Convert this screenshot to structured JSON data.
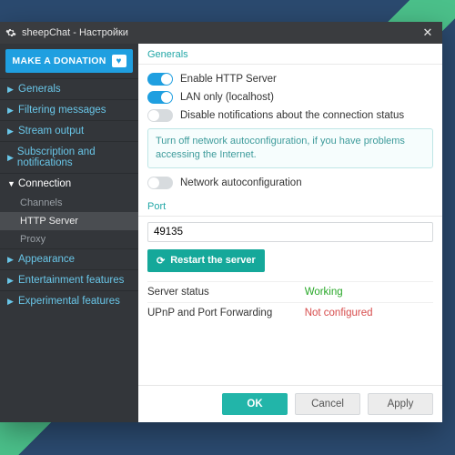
{
  "window": {
    "title": "sheepChat - Настройки"
  },
  "sidebar": {
    "donate_label": "MAKE A DONATION",
    "items": [
      {
        "label": "Generals"
      },
      {
        "label": "Filtering messages"
      },
      {
        "label": "Stream output"
      },
      {
        "label": "Subscription and notifications"
      },
      {
        "label": "Connection"
      },
      {
        "label": "Appearance"
      },
      {
        "label": "Entertainment features"
      },
      {
        "label": "Experimental features"
      }
    ],
    "connection_children": [
      {
        "label": "Channels"
      },
      {
        "label": "HTTP Server"
      },
      {
        "label": "Proxy"
      }
    ]
  },
  "main": {
    "section_generals": "Generals",
    "enable_http": "Enable HTTP Server",
    "lan_only": "LAN only (localhost)",
    "disable_notifications": "Disable notifications about the connection status",
    "info_text": "Turn off network autoconfiguration, if you have problems accessing the Internet.",
    "network_autoconf": "Network autoconfiguration",
    "section_port": "Port",
    "port_value": "49135",
    "restart_label": "Restart the server",
    "status": {
      "server_label": "Server status",
      "server_value": "Working",
      "upnp_label": "UPnP and Port Forwarding",
      "upnp_value": "Not configured"
    }
  },
  "footer": {
    "ok": "OK",
    "cancel": "Cancel",
    "apply": "Apply"
  }
}
